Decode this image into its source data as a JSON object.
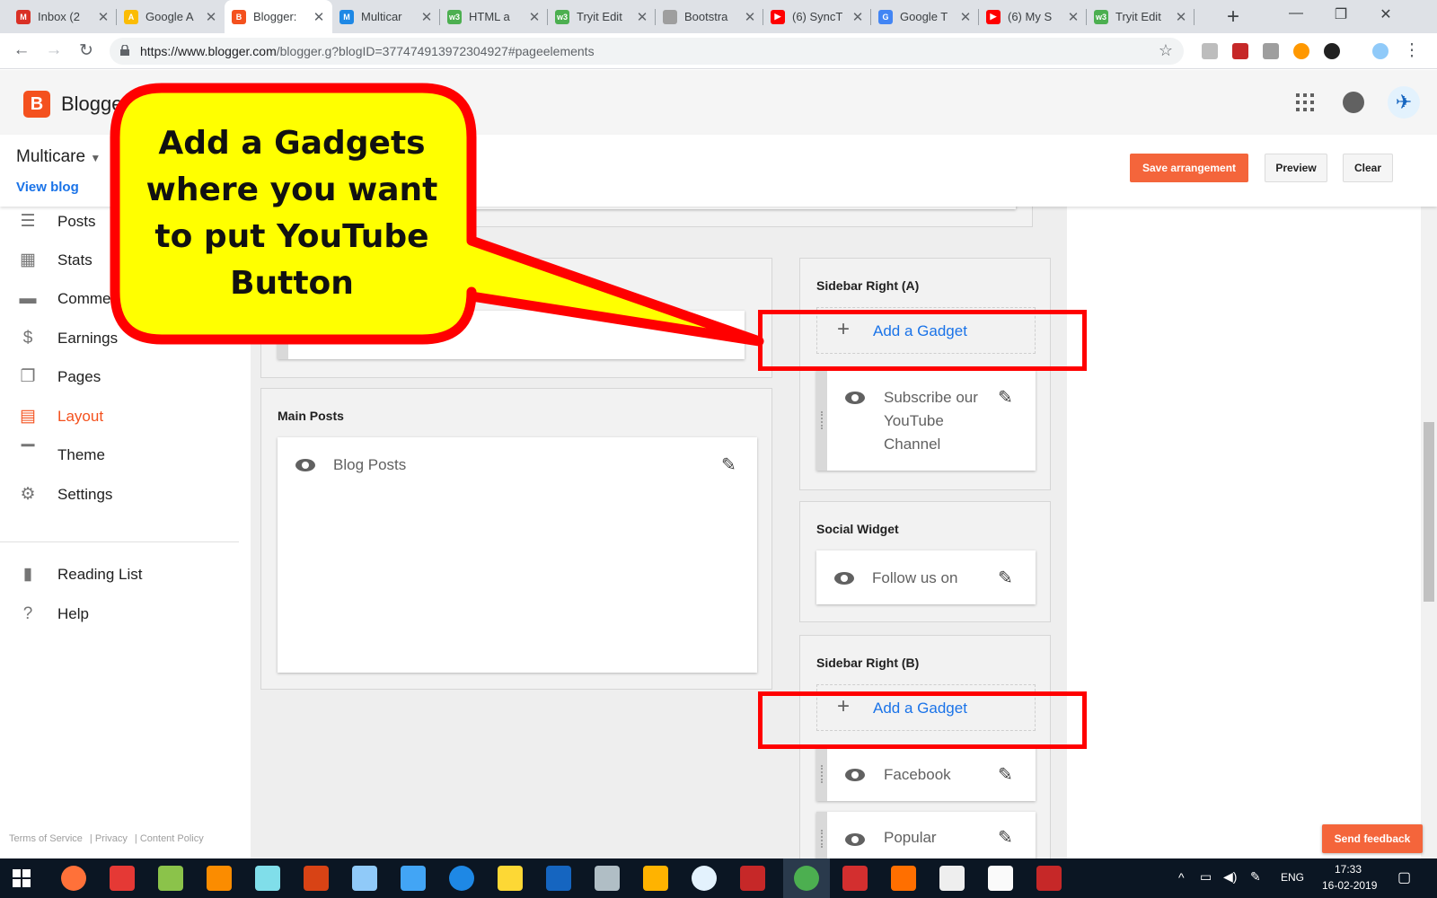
{
  "browser": {
    "tabs": [
      {
        "label": "Inbox (2",
        "icon": "gmail-icon",
        "color": "#d93025",
        "glyph": "M"
      },
      {
        "label": "Google A",
        "icon": "google-ads-icon",
        "color": "#fbbc04",
        "glyph": "A"
      },
      {
        "label": "Blogger:",
        "icon": "blogger-icon",
        "color": "#f4511e",
        "glyph": "B"
      },
      {
        "label": "Multicar",
        "icon": "multicare-icon",
        "color": "#1e88e5",
        "glyph": "M"
      },
      {
        "label": "HTML a",
        "icon": "w3schools-icon",
        "color": "#4caf50",
        "glyph": "w3"
      },
      {
        "label": "Tryit Edit",
        "icon": "w3schools-icon",
        "color": "#4caf50",
        "glyph": "w3"
      },
      {
        "label": "Bootstra",
        "icon": "document-icon",
        "color": "#9e9e9e",
        "glyph": ""
      },
      {
        "label": "(6) SyncT",
        "icon": "youtube-icon",
        "color": "#ff0000",
        "glyph": "▶"
      },
      {
        "label": "Google T",
        "icon": "google-translate-icon",
        "color": "#4285f4",
        "glyph": "G"
      },
      {
        "label": "(6) My S",
        "icon": "youtube-icon",
        "color": "#ff0000",
        "glyph": "▶"
      },
      {
        "label": "Tryit Edit",
        "icon": "w3schools-icon",
        "color": "#4caf50",
        "glyph": "w3"
      }
    ],
    "active_tab": 2,
    "url_host": "https://www.blogger.com",
    "url_path": "/blogger.g?blogID=377474913972304927#pageelements"
  },
  "header": {
    "logo_letter": "B",
    "app_name": "Blogger"
  },
  "subheader": {
    "blog_name": "Multicare",
    "view_blog": "View blog",
    "save_label": "Save arrangement",
    "preview_label": "Preview",
    "clear_label": "Clear"
  },
  "nav": {
    "items": [
      {
        "label": "Posts",
        "icon": "posts-icon",
        "glyph": "☰"
      },
      {
        "label": "Stats",
        "icon": "stats-icon",
        "glyph": "▦"
      },
      {
        "label": "Comments",
        "icon": "comments-icon",
        "glyph": "▬"
      },
      {
        "label": "Earnings",
        "icon": "earnings-icon",
        "glyph": "$"
      },
      {
        "label": "Pages",
        "icon": "pages-icon",
        "glyph": "❐"
      },
      {
        "label": "Layout",
        "icon": "layout-icon",
        "glyph": "▤"
      },
      {
        "label": "Theme",
        "icon": "theme-icon",
        "glyph": "▔"
      },
      {
        "label": "Settings",
        "icon": "settings-icon",
        "glyph": "⚙"
      }
    ],
    "active_index": 5,
    "reading_list": "Reading List",
    "help": "Help",
    "footer": [
      "Terms of Service",
      "Privacy",
      "Content Policy"
    ]
  },
  "layout": {
    "partial_gadget_tail": "t",
    "main_posts": {
      "title": "Main Posts",
      "gadget": "Blog Posts"
    },
    "sidebar_a": {
      "title": "Sidebar Right (A)",
      "add_label": "Add a Gadget",
      "gadget_lines": [
        "Subscribe our",
        "YouTube",
        "Channel"
      ]
    },
    "social": {
      "title": "Social Widget",
      "gadget": "Follow us on"
    },
    "sidebar_b": {
      "title": "Sidebar Right (B)",
      "add_label": "Add a Gadget",
      "gadgets": [
        "Facebook",
        "Popular"
      ]
    }
  },
  "callout": {
    "lines": [
      "Add a Gadgets",
      "where you want",
      "to put YouTube",
      "Button"
    ],
    "fill_color": "#ffff00",
    "border_color": "#ff0000"
  },
  "feedback": "Send feedback",
  "taskbar": {
    "language": "ENG",
    "time": "17:33",
    "date": "16-02-2019"
  }
}
